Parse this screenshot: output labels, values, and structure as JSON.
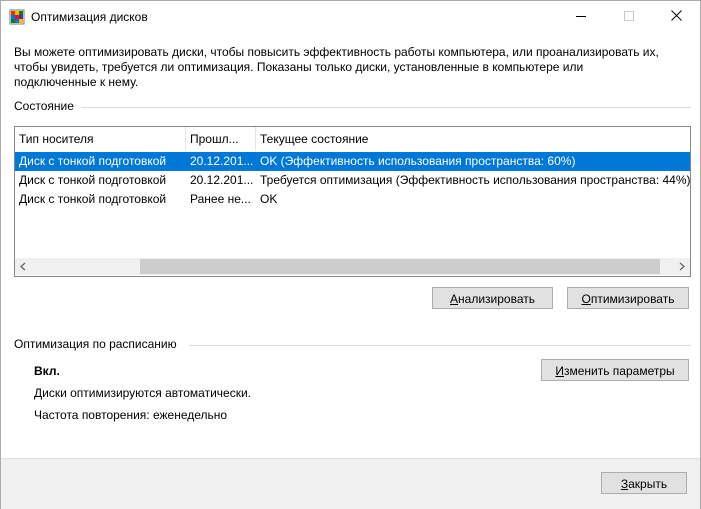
{
  "window": {
    "title": "Оптимизация дисков"
  },
  "description": "Вы можете оптимизировать диски, чтобы повысить эффективность работы  компьютера, или проанализировать их, чтобы увидеть, требуется ли оптимизация. Показаны только диски, установленные в компьютере или подключенные к нему.",
  "status_group": {
    "label": "Состояние",
    "columns": [
      "Тип носителя",
      "Прошл...",
      "Текущее состояние"
    ],
    "rows": [
      {
        "media": "Диск с тонкой подготовкой",
        "last": "20.12.201...",
        "state": "OK (Эффективность использования пространства: 60%)",
        "selected": true
      },
      {
        "media": "Диск с тонкой подготовкой",
        "last": "20.12.201...",
        "state": "Требуется оптимизация (Эффективность использования пространства: 44%)",
        "selected": false
      },
      {
        "media": "Диск с тонкой подготовкой",
        "last": "Ранее не...",
        "state": "OK",
        "selected": false
      }
    ],
    "scroll_left_icon": "chevron-left",
    "scroll_right_icon": "chevron-right"
  },
  "buttons": {
    "analyze_pre": "",
    "analyze_ul": "А",
    "analyze_post": "нализировать",
    "optimize_pre": "",
    "optimize_ul": "О",
    "optimize_post": "птимизировать",
    "change_pre": "",
    "change_ul": "И",
    "change_post": "зменить параметры",
    "close_pre": "",
    "close_ul": "З",
    "close_post": "акрыть"
  },
  "schedule_group": {
    "label": "Оптимизация по расписанию",
    "state": "Вкл.",
    "auto_text": "Диски оптимизируются автоматически.",
    "frequency": "Частота повторения: еженедельно"
  },
  "colors": {
    "selection": "#0078d7",
    "window_bg": "#ffffff",
    "chrome_bg": "#f0f0f0"
  }
}
